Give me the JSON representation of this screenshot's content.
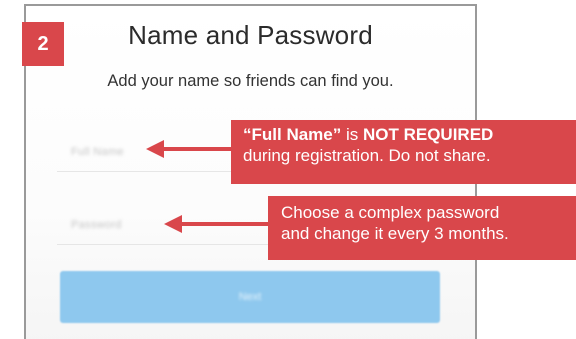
{
  "step": {
    "number": "2"
  },
  "screen": {
    "title": "Name and Password",
    "subtitle": "Add your name so friends can find you.",
    "fullname_placeholder": "Full Name",
    "password_placeholder": "Password",
    "next_label": "Next"
  },
  "annotations": {
    "fullname": {
      "quoted_field": "“Full Name”",
      "is_text": " is ",
      "emphasis": "NOT REQUIRED",
      "rest": "during registration. Do not share."
    },
    "password": {
      "line1": "Choose a complex password",
      "line2": "and change it every 3 months."
    }
  },
  "colors": {
    "accent_red": "#d9474b",
    "button_blue": "#8ec8ee",
    "card_border": "#9a9a9a"
  }
}
